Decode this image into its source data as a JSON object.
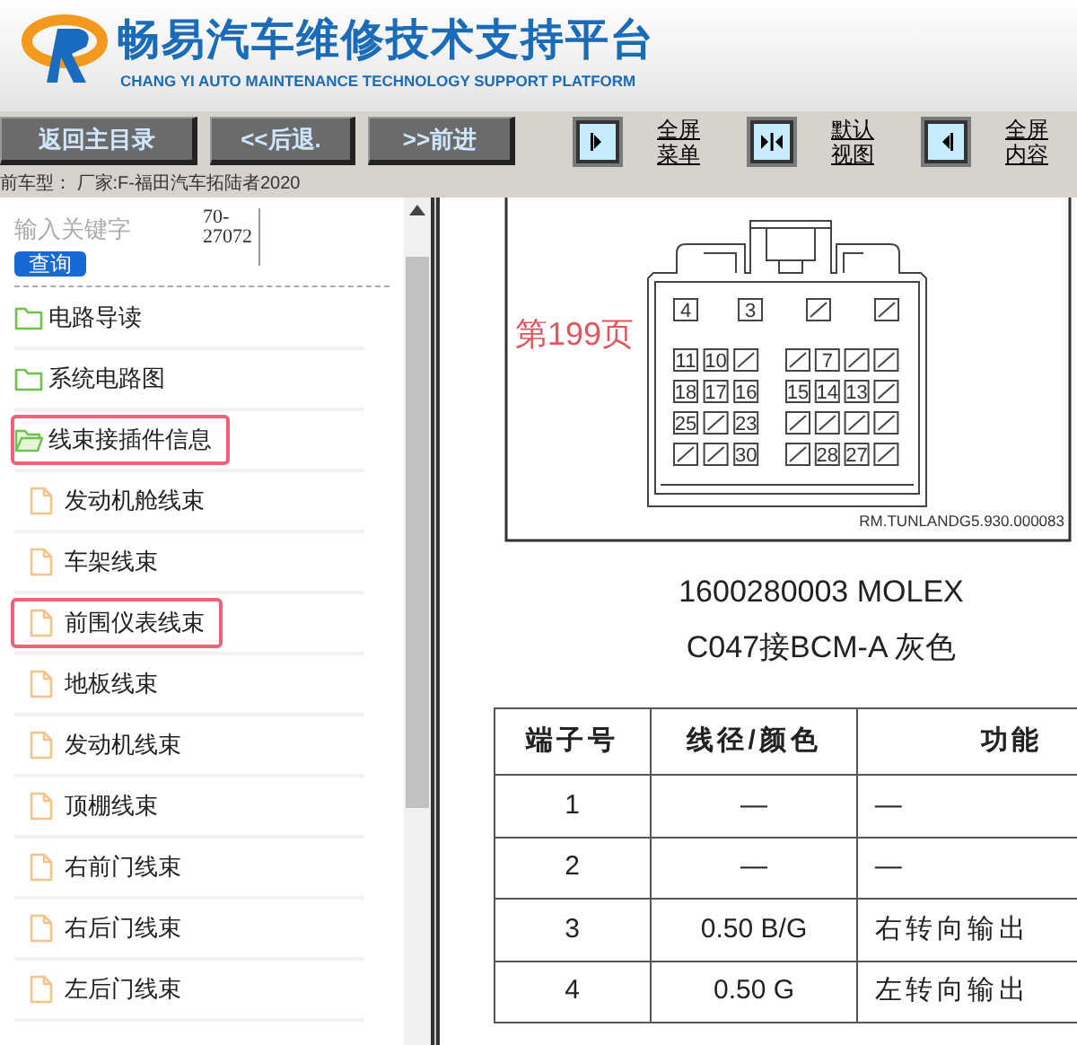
{
  "header": {
    "title": "畅易汽车维修技术支持平台",
    "subtitle": "CHANG YI AUTO MAINTENANCE TECHNOLOGY SUPPORT PLATFORM"
  },
  "nav_buttons": [
    "返回主目录",
    "<<后退.",
    ">>前进"
  ],
  "view_buttons": [
    {
      "kind": "menu",
      "label": "全屏菜单"
    },
    {
      "kind": "default",
      "label": "默认视图"
    },
    {
      "kind": "content",
      "label": "全屏内容"
    }
  ],
  "status_line": "前车型：  厂家:F-福田汽车拓陆者2020",
  "sidebar": {
    "search": {
      "placeholder": "输入关键字",
      "side_text": "70-27072"
    },
    "search_button": "查询",
    "tree": [
      {
        "kind": "folder",
        "label": "电路导读",
        "expanded": false,
        "highlighted": false
      },
      {
        "kind": "folder",
        "label": "系统电路图",
        "expanded": false,
        "highlighted": false
      },
      {
        "kind": "folder",
        "label": "线束接插件信息",
        "expanded": true,
        "highlighted": true,
        "children": [
          {
            "kind": "file",
            "label": "发动机舱线束",
            "highlighted": false
          },
          {
            "kind": "file",
            "label": "车架线束",
            "highlighted": false
          },
          {
            "kind": "file",
            "label": "前围仪表线束",
            "highlighted": true
          },
          {
            "kind": "file",
            "label": "地板线束",
            "highlighted": false
          },
          {
            "kind": "file",
            "label": "发动机线束",
            "highlighted": false
          },
          {
            "kind": "file",
            "label": "顶棚线束",
            "highlighted": false
          },
          {
            "kind": "file",
            "label": "右前门线束",
            "highlighted": false
          },
          {
            "kind": "file",
            "label": "右后门线束",
            "highlighted": false
          },
          {
            "kind": "file",
            "label": "左后门线束",
            "highlighted": false
          }
        ]
      }
    ]
  },
  "content": {
    "page_label": "第199页",
    "diagram": {
      "code": "RM.TUNLANDG5.930.000083",
      "top_row": [
        {
          "kind": "pin",
          "label": "4"
        },
        {
          "kind": "pin",
          "label": "3"
        },
        {
          "kind": "blocked"
        },
        {
          "kind": "blocked"
        }
      ],
      "left_rows": [
        [
          {
            "kind": "pin",
            "label": "11"
          },
          {
            "kind": "pin",
            "label": "10"
          },
          {
            "kind": "blocked"
          }
        ],
        [
          {
            "kind": "pin",
            "label": "18"
          },
          {
            "kind": "pin",
            "label": "17"
          },
          {
            "kind": "pin",
            "label": "16"
          }
        ],
        [
          {
            "kind": "pin",
            "label": "25"
          },
          {
            "kind": "blocked"
          },
          {
            "kind": "pin",
            "label": "23"
          }
        ],
        [
          {
            "kind": "blocked"
          },
          {
            "kind": "blocked"
          },
          {
            "kind": "pin",
            "label": "30"
          }
        ]
      ],
      "right_rows": [
        [
          {
            "kind": "blocked"
          },
          {
            "kind": "pin",
            "label": "7"
          },
          {
            "kind": "blocked"
          },
          {
            "kind": "blocked"
          }
        ],
        [
          {
            "kind": "pin",
            "label": "15"
          },
          {
            "kind": "pin",
            "label": "14"
          },
          {
            "kind": "pin",
            "label": "13"
          },
          {
            "kind": "blocked"
          }
        ],
        [
          {
            "kind": "blocked"
          },
          {
            "kind": "blocked"
          },
          {
            "kind": "blocked"
          },
          {
            "kind": "blocked"
          }
        ],
        [
          {
            "kind": "blocked"
          },
          {
            "kind": "pin",
            "label": "28"
          },
          {
            "kind": "pin",
            "label": "27"
          },
          {
            "kind": "blocked"
          }
        ]
      ]
    },
    "part_number": "1600280003 MOLEX",
    "connector_name": "C047接BCM-A 灰色",
    "table": {
      "columns": [
        "端子号",
        "线径/颜色",
        "功能"
      ],
      "rows": [
        [
          "1",
          "—",
          "—"
        ],
        [
          "2",
          "—",
          "—"
        ],
        [
          "3",
          "0.50 B/G",
          "右转向输出"
        ],
        [
          "4",
          "0.50 G",
          "左转向输出"
        ]
      ]
    }
  }
}
